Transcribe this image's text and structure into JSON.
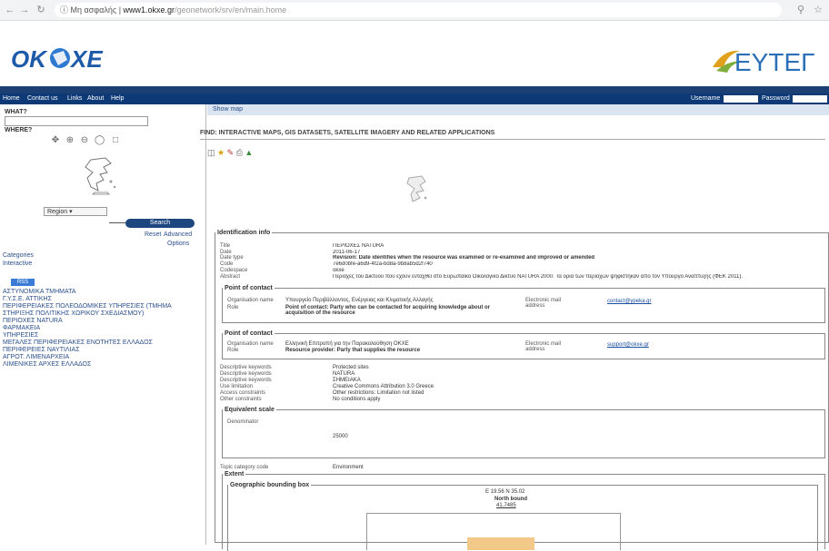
{
  "browser": {
    "security_label": "Μη ασφαλής",
    "url_host": "www1.okxe.gr",
    "url_path": "/geonetwork/srv/en/main.home"
  },
  "header": {
    "logo_left": "OKXE",
    "logo_right": "EYTEr",
    "menu": [
      "Home",
      "Contact us",
      "Links",
      "About",
      "Help"
    ],
    "login": {
      "username_label": "Username",
      "password_label": "Password"
    }
  },
  "sidebar": {
    "what_label": "WHAT?",
    "where_label": "WHERE?",
    "region_value": "Region",
    "search_button": "Search",
    "reset_link": "Reset",
    "advanced_link": "Advanced",
    "options_link": "Options",
    "categories_link": "Categories",
    "interactive_link": "Interactive",
    "feed_badge": "RSS",
    "layers": [
      "ΑΣΤΥΝΟΜΙΚΑ ΤΜΗΜΑΤΑ",
      "Γ.Υ.Σ.Ε. ΑΤΤΙΚΗΣ",
      "ΠΕΡΙΦΕΡΕΙΑΚΕΣ ΠΟΛΕΟΔΟΜΙΚΕΣ ΥΠΗΡΕΣΙΕΣ (ΤΜΗΜΑ ΣΤΗΡΙΞΗΣ ΠΟΛΙΤΙΚΗΣ ΧΩΡΙΚΟΥ ΣΧΕΔΙΑΣΜΟΥ)",
      "ΠΕΡΙΟΧΕΣ NATURA",
      "ΦΑΡΜΑΚΕΙΑ",
      "ΥΠΗΡΕΣΙΕΣ",
      "ΜΕΓΑΛΕΣ ΠΕΡΙΦΕΡΕΙΑΚΕΣ ΕΝΟΤΗΤΕΣ ΕΛΛΑΔΟΣ",
      "ΠΕΡΙΦΕΡΕΙΕΣ ΝΑΥΤΙΛΙΑΣ",
      "ΑΓΡΟΤ. ΛΙΜΕΝΑΡΧΕΙΑ",
      "ΛΙΜΕΝΙΚΕΣ ΑΡΧΕΣ ΕΛΛΑΔΟΣ"
    ]
  },
  "main": {
    "show_map": "Show map",
    "title": "FIND: INTERACTIVE MAPS, GIS DATASETS, SATELLITE IMAGERY AND RELATED APPLICATIONS",
    "ident": {
      "legend": "Identification info",
      "rows": [
        {
          "k": "Title",
          "v": "ΠΕΡΙΟΧΕΣ NATURA"
        },
        {
          "k": "Date",
          "v": "2011-06-17"
        },
        {
          "k": "Date type",
          "v": "Revision: Date identifies when the resource was examined or re-examined and improved or amended"
        },
        {
          "k": "Code",
          "v": "7e6d0bfe-a6d9-4f2a-bd8a-9b8ab5d2f740"
        },
        {
          "k": "Codespace",
          "v": "okxe"
        },
        {
          "k": "Abstract",
          "v": "Περιοχές του Δικτύου που έχουν ενταχθεί στο Ευρωπαϊκό Οικολογικό Δίκτυο NATURA 2000. Τα όρια των περιοχών ψηφίστηκαν από τον Υπουργό Ανάπτυξης (ΦΕΚ 2011)."
        }
      ],
      "poc1": {
        "legend": "Point of contact",
        "org_label": "Organisation name",
        "org": "Υπουργείο Περιβάλλοντος, Ενέργειας και Κλιματικής Αλλαγής",
        "role_label": "Role",
        "role": "Point of contact: Party who can be contacted for acquiring knowledge about or acquisition of the resource",
        "email_label": "Electronic mail address",
        "email": "contact@ypeka.gr"
      },
      "poc2": {
        "legend": "Point of contact",
        "org_label": "Organisation name",
        "org": "Ελληνική Επιτροπή για την Παρακολούθηση ΟΚΧΕ",
        "role_label": "Role",
        "role": "Resource provider: Party that supplies the resource",
        "email_label": "Electronic mail address",
        "email": "support@okxe.gr"
      },
      "keywords": [
        {
          "k": "Descriptive keywords",
          "v": "Protected sites"
        },
        {
          "k": "Descriptive keywords",
          "v": "NATURA"
        },
        {
          "k": "Descriptive keywords",
          "v": "ΣΗΜΕΙΑΚΑ"
        },
        {
          "k": "Use limitation",
          "v": "Creative Commons Attribution 3.0 Greece"
        },
        {
          "k": "Access constraints",
          "v": "Other restrictions: Limitation not listed"
        },
        {
          "k": "Other constraints",
          "v": "No conditions apply"
        }
      ],
      "scale": {
        "legend": "Equivalent scale",
        "label": "Denominator",
        "value": "25000"
      },
      "topic": {
        "k": "Topic category code",
        "v": "Environment"
      },
      "extent": {
        "legend": "Extent",
        "bbox_legend": "Geographic bounding box",
        "north_label": "North bound",
        "north": "41.7485",
        "coords": "E 19.56 N 35.02"
      }
    }
  }
}
